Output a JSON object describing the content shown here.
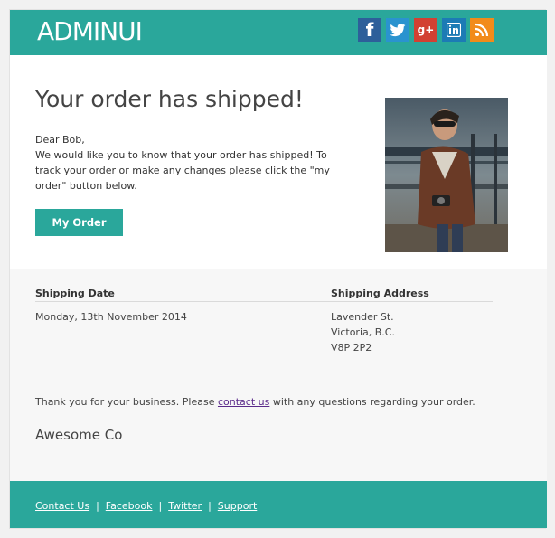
{
  "header": {
    "brand": "ADMINUI",
    "social": [
      {
        "name": "facebook-icon",
        "glyph": "f"
      },
      {
        "name": "twitter-icon",
        "glyph": "t"
      },
      {
        "name": "google-plus-icon",
        "glyph": "g+"
      },
      {
        "name": "linkedin-icon",
        "glyph": "in"
      },
      {
        "name": "rss-icon",
        "glyph": "rss"
      }
    ]
  },
  "main": {
    "headline": "Your order has shipped!",
    "greeting": "Dear Bob,",
    "body": "We would like you to know that your order has shipped! To track your order or make any changes please click the \"my order\" button below.",
    "button_label": "My Order"
  },
  "shipping": {
    "date_label": "Shipping Date",
    "date_value": "Monday, 13th November 2014",
    "address_label": "Shipping Address",
    "address_lines": [
      "Lavender St.",
      "Victoria, B.C.",
      "V8P 2P2"
    ]
  },
  "closing": {
    "thanks_prefix": "Thank you for your business. Please ",
    "contact_link": "contact us",
    "thanks_suffix": " with any questions regarding your order.",
    "company": "Awesome Co"
  },
  "footer": {
    "links": [
      "Contact Us",
      "Facebook",
      "Twitter",
      "Support"
    ],
    "separator": "|"
  },
  "colors": {
    "accent": "#2aa79b",
    "link": "#5a2a8a"
  }
}
